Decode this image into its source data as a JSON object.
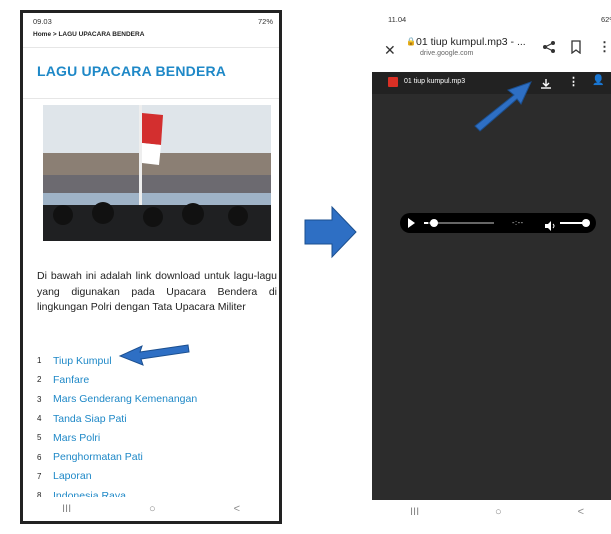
{
  "left_phone": {
    "status": {
      "time": "09.03",
      "right": "72%"
    },
    "breadcrumb": "Home > LAGU UPACARA BENDERA",
    "page_title": "LAGU UPACARA BENDERA",
    "description": "Di bawah ini adalah link download untuk lagu-lagu yang digunakan pada Upacara Bendera di lingkungan Polri dengan Tata Upacara Militer",
    "songs": [
      {
        "num": "1",
        "title": "Tiup Kumpul"
      },
      {
        "num": "2",
        "title": "Fanfare"
      },
      {
        "num": "3",
        "title": "Mars Genderang Kemenangan"
      },
      {
        "num": "4",
        "title": "Tanda Siap Pati"
      },
      {
        "num": "5",
        "title": "Mars Polri"
      },
      {
        "num": "6",
        "title": "Penghormatan Pati"
      },
      {
        "num": "7",
        "title": "Laporan"
      },
      {
        "num": "8",
        "title": "Indonesia Raya"
      }
    ],
    "nav": {
      "recents": "III",
      "home": "○",
      "back": "<"
    }
  },
  "right_phone": {
    "status": {
      "time": "11.04",
      "right": "62%"
    },
    "tab_title": "01 tiup kumpul.mp3 - ...",
    "domain": "drive.google.com",
    "viewer_filename": "01 tiup kumpul.mp3",
    "player": {
      "time": "-:--",
      "progress": 0.05
    },
    "nav": {
      "recents": "III",
      "home": "○",
      "back": "<"
    }
  },
  "colors": {
    "link": "#1e88c7",
    "arrow": "#2e6fc4",
    "viewer_bg": "#2c2c2c"
  }
}
